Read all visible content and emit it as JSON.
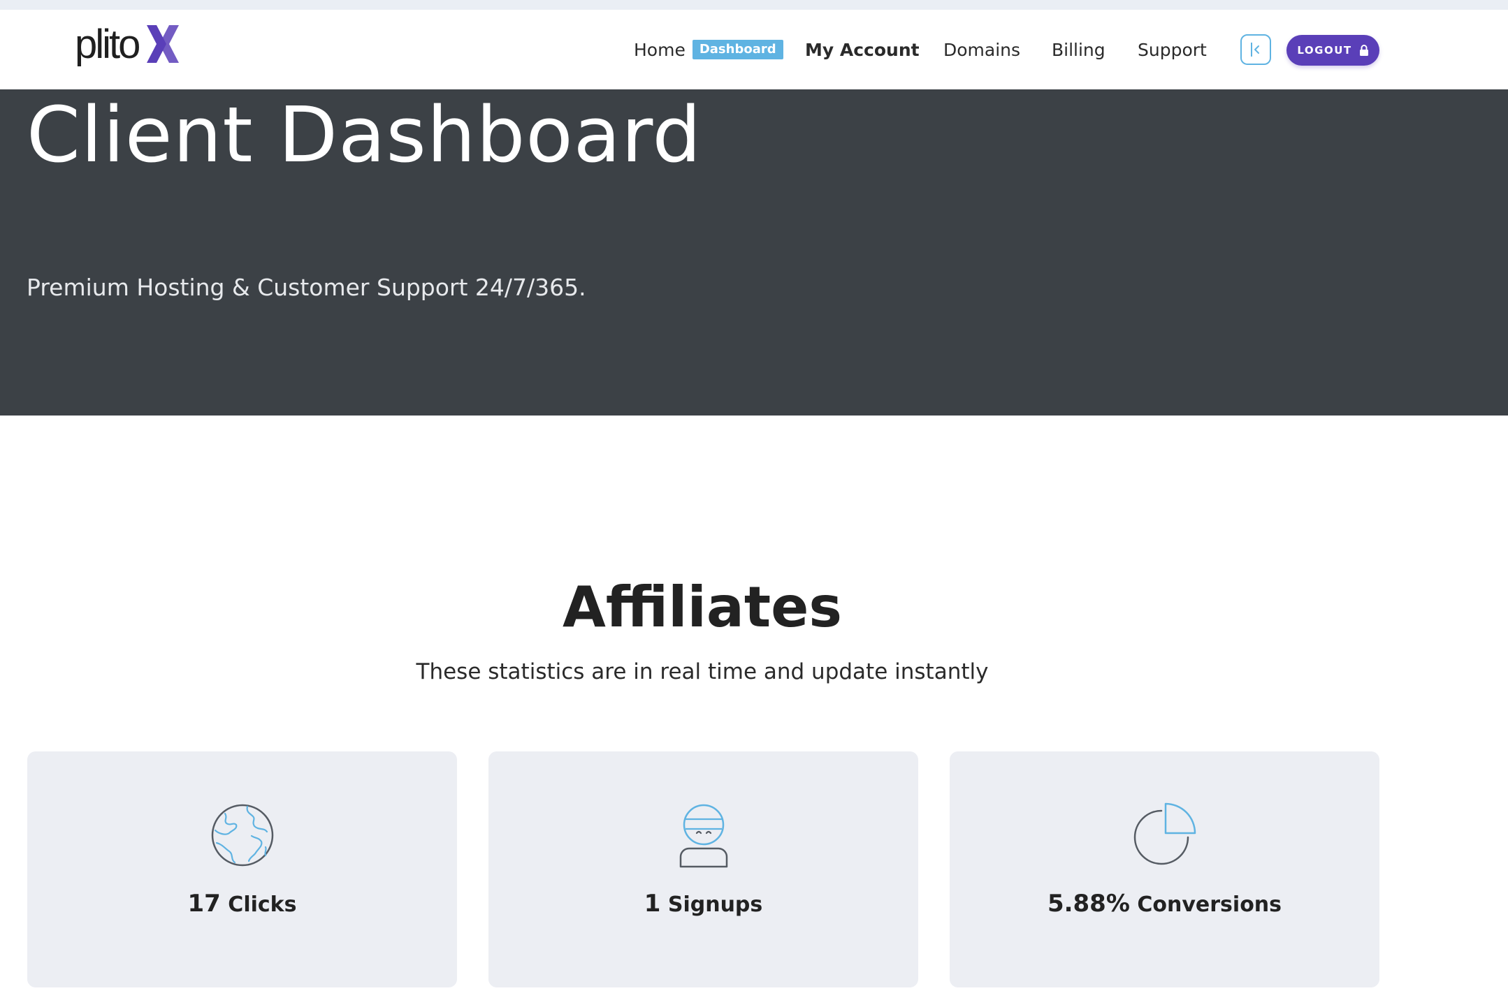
{
  "brand": {
    "logo_text": "plito",
    "logo_mark": "X",
    "accent": "#5a3fb8",
    "highlight": "#5fb3e2"
  },
  "nav": {
    "home": "Home",
    "home_badge": "Dashboard",
    "my_account": "My Account",
    "domains": "Domains",
    "billing": "Billing",
    "support": "Support",
    "sidebar_toggle_icon": "collapse-sidebar-icon",
    "logout": "LOGOUT",
    "logout_icon": "lock-icon"
  },
  "hero": {
    "title": "Client Dashboard",
    "subtitle": "Premium Hosting & Customer Support 24/7/365.",
    "background": "#3c4146"
  },
  "affiliates": {
    "title": "Affiliates",
    "subtitle": "These statistics are in real time and update instantly",
    "cards": [
      {
        "icon": "globe-icon",
        "value": "17",
        "label": "Clicks"
      },
      {
        "icon": "user-icon",
        "value": "1",
        "label": "Signups"
      },
      {
        "icon": "pie-chart-icon",
        "value": "5.88%",
        "label": "Conversions"
      }
    ]
  }
}
